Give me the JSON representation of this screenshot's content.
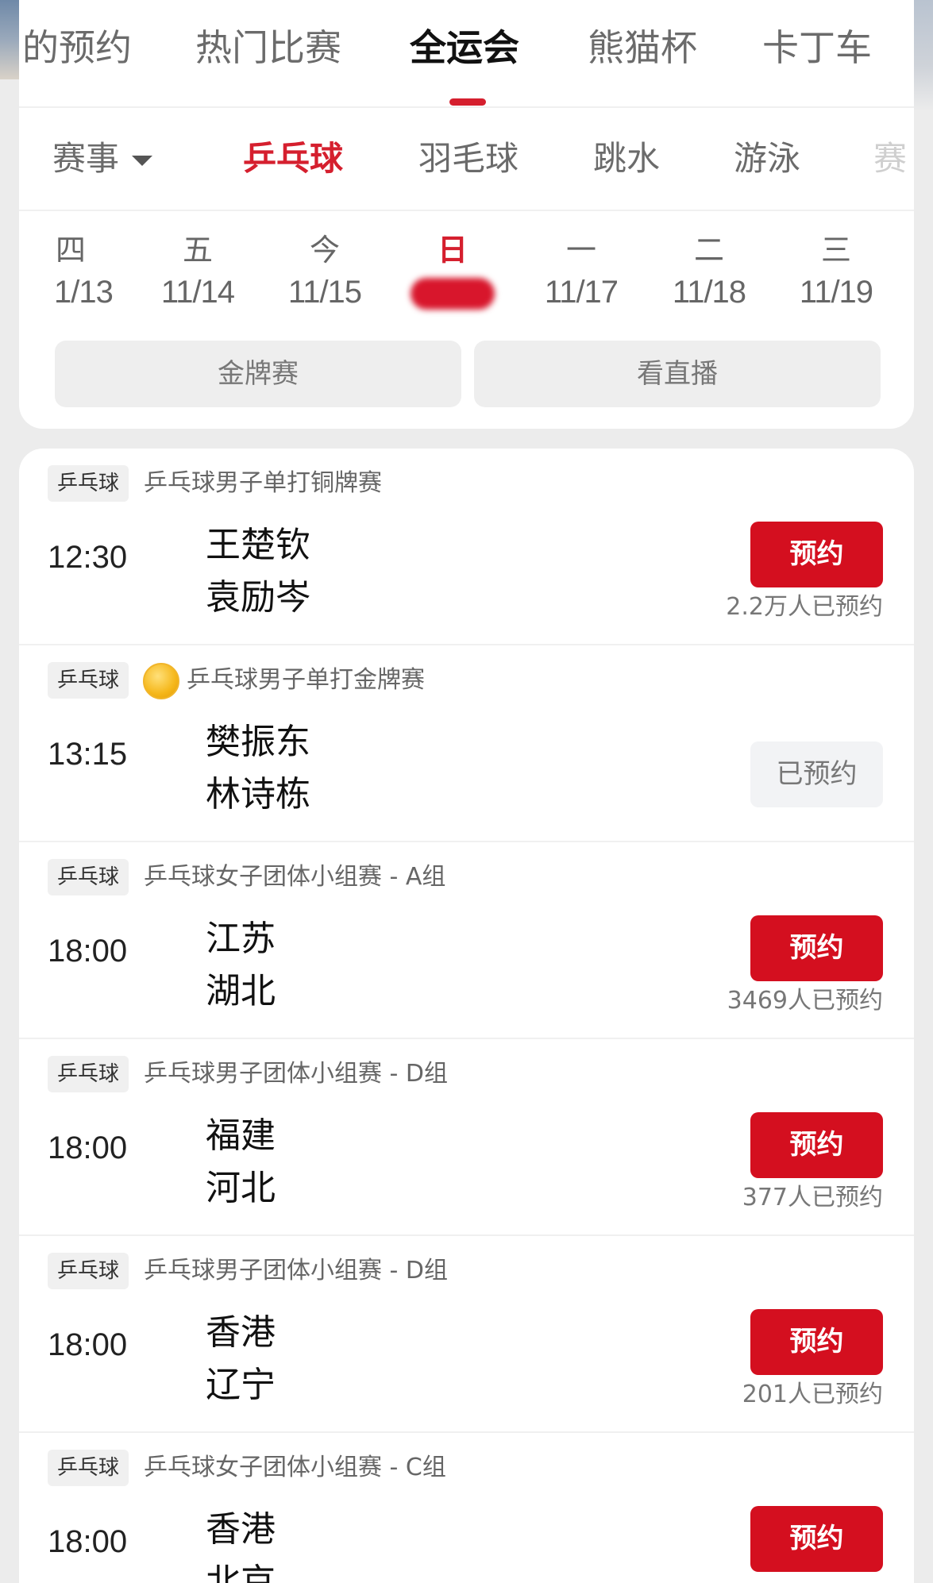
{
  "main_tabs": [
    "的预约",
    "热门比赛",
    "全运会",
    "熊猫杯",
    "卡丁车"
  ],
  "sport_tabs": {
    "filter": "赛事",
    "items": [
      "乒乓球",
      "羽毛球",
      "跳水",
      "游泳",
      "赛"
    ]
  },
  "dates": [
    {
      "weekday": "四",
      "date": "1/13"
    },
    {
      "weekday": "五",
      "date": "11/14"
    },
    {
      "weekday": "今",
      "date": "11/15"
    },
    {
      "weekday": "日",
      "date": ""
    },
    {
      "weekday": "一",
      "date": "11/17"
    },
    {
      "weekday": "二",
      "date": "11/18"
    },
    {
      "weekday": "三",
      "date": "11/19"
    }
  ],
  "filters": {
    "gold": "金牌赛",
    "live": "看直播"
  },
  "matches": [
    {
      "tag": "乒乓球",
      "event": "乒乓球男子单打铜牌赛",
      "time": "12:30",
      "team1": "王楚钦",
      "team2": "袁励岑",
      "button": "预约",
      "count": "2.2万人已预约"
    },
    {
      "tag": "乒乓球",
      "event": "乒乓球男子单打金牌赛",
      "time": "13:15",
      "team1": "樊振东",
      "team2": "林诗栋",
      "button": "已预约",
      "count": ""
    },
    {
      "tag": "乒乓球",
      "event": "乒乓球女子团体小组赛 - A组",
      "time": "18:00",
      "team1": "江苏",
      "team2": "湖北",
      "button": "预约",
      "count": "3469人已预约"
    },
    {
      "tag": "乒乓球",
      "event": "乒乓球男子团体小组赛 - D组",
      "time": "18:00",
      "team1": "福建",
      "team2": "河北",
      "button": "预约",
      "count": "377人已预约"
    },
    {
      "tag": "乒乓球",
      "event": "乒乓球男子团体小组赛 - D组",
      "time": "18:00",
      "team1": "香港",
      "team2": "辽宁",
      "button": "预约",
      "count": "201人已预约"
    },
    {
      "tag": "乒乓球",
      "event": "乒乓球女子团体小组赛 - C组",
      "time": "18:00",
      "team1": "香港",
      "team2": "北京",
      "button": "预约",
      "count": ""
    }
  ],
  "colors": {
    "accent": "#d51f2e",
    "button": "#d40f1f",
    "medal": "#f5b71a"
  }
}
